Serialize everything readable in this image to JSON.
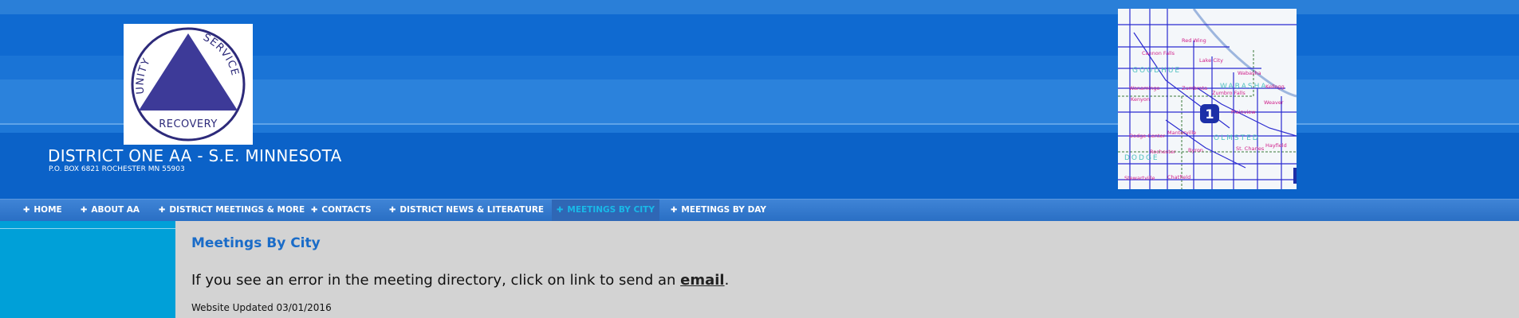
{
  "header": {
    "title": "DISTRICT ONE AA - S.E. MINNESOTA",
    "address": "P.O. BOX 6821 ROCHESTER MN 55903",
    "logo": {
      "words": [
        "UNITY",
        "SERVICE",
        "RECOVERY"
      ],
      "color": "#3d3a98"
    },
    "map": {
      "district_number": "1",
      "region_labels": [
        "GOODHUE",
        "WABASHA",
        "DODGE",
        "OLMSTED"
      ],
      "towns": [
        "Cannon Falls",
        "Red Wing",
        "Lake City",
        "Wabasha",
        "Wanamingo",
        "Zumbrota",
        "Kenyon",
        "Mazeppa",
        "Zumbro Falls",
        "Kellogg",
        "Weaver",
        "Pine Island",
        "Plainview",
        "Mantorville",
        "Dodge Center",
        "Kasson",
        "Rochester",
        "Byron",
        "Eyota",
        "St. Charles",
        "Hayfield",
        "Stewartville",
        "Chatfield"
      ]
    }
  },
  "nav": {
    "items": [
      {
        "label": "HOME"
      },
      {
        "label": "ABOUT AA"
      },
      {
        "label": "DISTRICT MEETINGS & MORE"
      },
      {
        "label": "CONTACTS"
      },
      {
        "label": "DISTRICT NEWS & LITERATURE"
      },
      {
        "label": "MEETINGS BY CITY"
      },
      {
        "label": "MEETINGS BY DAY"
      }
    ],
    "active": "MEETINGS BY CITY"
  },
  "main": {
    "heading": "Meetings By City",
    "notice_prefix": "If you see an error in the meeting directory, click on link to send an ",
    "notice_link": "email",
    "notice_suffix": ".",
    "updated": "Website Updated 03/01/2016"
  },
  "colors": {
    "header_blue": "#0a63c9",
    "nav_blue": "#3f84d6",
    "active_text": "#18b9e8",
    "sidebar": "#00a0d8",
    "heading": "#1a6cc8",
    "content_bg": "#d3d3d3"
  }
}
